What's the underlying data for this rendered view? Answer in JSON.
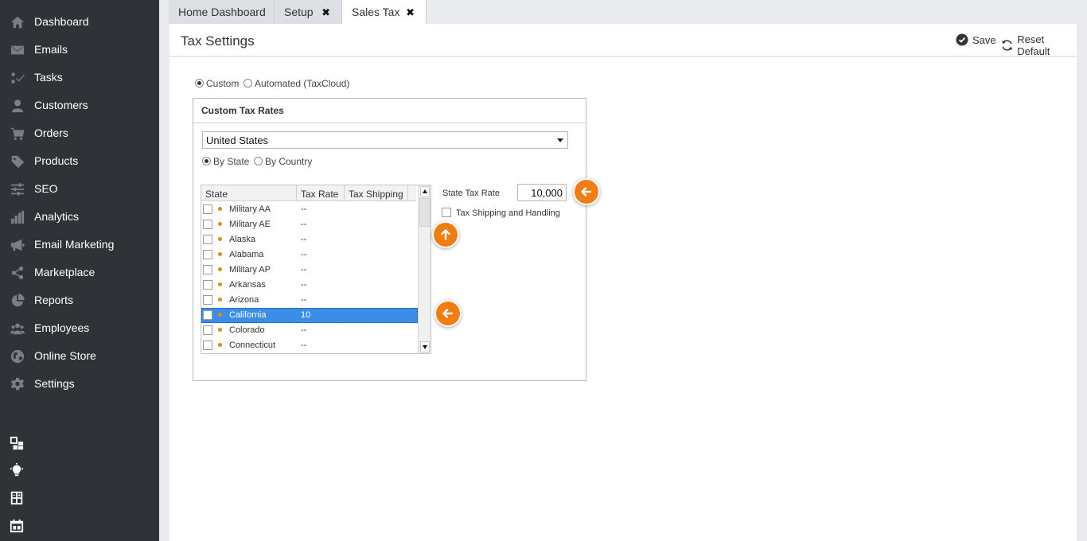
{
  "sidebar": {
    "items": [
      {
        "label": "Dashboard",
        "icon": "home-icon"
      },
      {
        "label": "Emails",
        "icon": "envelope-icon"
      },
      {
        "label": "Tasks",
        "icon": "tasks-icon"
      },
      {
        "label": "Customers",
        "icon": "person-icon"
      },
      {
        "label": "Orders",
        "icon": "cart-icon"
      },
      {
        "label": "Products",
        "icon": "tag-icon"
      },
      {
        "label": "SEO",
        "icon": "sliders-icon"
      },
      {
        "label": "Analytics",
        "icon": "bar-chart-icon"
      },
      {
        "label": "Email Marketing",
        "icon": "megaphone-icon"
      },
      {
        "label": "Marketplace",
        "icon": "share-icon"
      },
      {
        "label": "Reports",
        "icon": "pie-chart-icon"
      },
      {
        "label": "Employees",
        "icon": "group-icon"
      },
      {
        "label": "Online Store",
        "icon": "globe-icon"
      },
      {
        "label": "Settings",
        "icon": "gear-icon"
      }
    ],
    "bottom_icons": [
      "widgets-icon",
      "lightbulb-icon",
      "calculator-icon",
      "calendar-icon"
    ]
  },
  "tabs": [
    {
      "label": "Home Dashboard",
      "closable": false,
      "active": false
    },
    {
      "label": "Setup",
      "closable": true,
      "active": false
    },
    {
      "label": "Sales Tax",
      "closable": true,
      "active": true
    }
  ],
  "tab_close_glyph": "✖",
  "header": {
    "title": "Tax Settings",
    "save_label": "Save",
    "reset_label": "Reset Default"
  },
  "mode": {
    "custom_label": "Custom",
    "automated_label": "Automated (TaxCloud)",
    "selected": "custom"
  },
  "panel": {
    "title": "Custom Tax Rates",
    "country_value": "United States",
    "by_state_label": "By State",
    "by_country_label": "By Country",
    "selected_scope": "state"
  },
  "grid": {
    "columns": [
      "State",
      "Tax Rate",
      "Tax Shipping"
    ],
    "rows": [
      {
        "state": "Military AA",
        "rate": "--"
      },
      {
        "state": "Military AE",
        "rate": "--"
      },
      {
        "state": "Alaska",
        "rate": "--"
      },
      {
        "state": "Alabama",
        "rate": "--"
      },
      {
        "state": "Military AP",
        "rate": "--"
      },
      {
        "state": "Arkansas",
        "rate": "--"
      },
      {
        "state": "Arizona",
        "rate": "--"
      },
      {
        "state": "California",
        "rate": "10"
      },
      {
        "state": "Colorado",
        "rate": "--"
      },
      {
        "state": "Connecticut",
        "rate": "--"
      }
    ],
    "selected_row": 7
  },
  "rate_panel": {
    "state_tax_rate_label": "State Tax Rate",
    "state_tax_rate_value": "10,000",
    "tax_shipping_label": "Tax Shipping and Handling"
  },
  "colors": {
    "sidebar_bg": "#2f3338",
    "accent_orange": "#f07c14",
    "selection_blue": "#3b8ee8"
  }
}
